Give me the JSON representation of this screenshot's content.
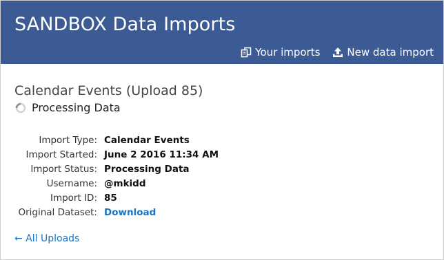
{
  "header": {
    "title": "SANDBOX Data Imports",
    "nav": {
      "your_imports": {
        "label": "Your imports",
        "icon": "copy-icon"
      },
      "new_import": {
        "label": "New data import",
        "icon": "upload-icon"
      }
    },
    "background": "#3c5a94"
  },
  "upload": {
    "title": "Calendar Events (Upload 85)",
    "status": "Processing Data",
    "status_icon": "spinner-icon"
  },
  "details": {
    "rows": [
      {
        "label": "Import Type:",
        "value": "Calendar Events"
      },
      {
        "label": "Import Started:",
        "value": "June 2 2016 11:34 AM"
      },
      {
        "label": "Import Status:",
        "value": "Processing Data"
      },
      {
        "label": "Username:",
        "value": "@mkidd"
      },
      {
        "label": "Import ID:",
        "value": "85"
      },
      {
        "label": "Original Dataset:",
        "value": "Download"
      }
    ]
  },
  "back_link": "← All Uploads",
  "colors": {
    "link": "#1a73c4"
  }
}
